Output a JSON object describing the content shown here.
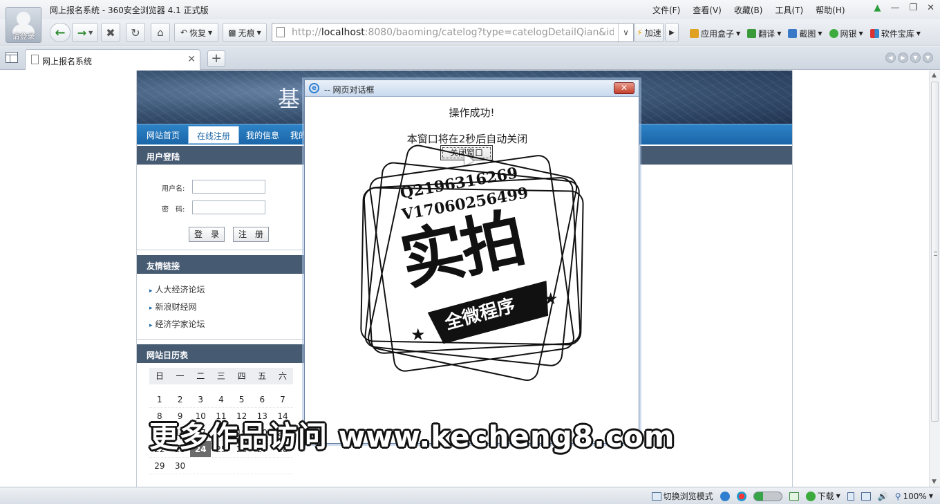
{
  "window": {
    "title": "网上报名系统 - 360安全浏览器 4.1 正式版",
    "login_label": "请登录",
    "menu": [
      "文件(F)",
      "查看(V)",
      "收藏(B)",
      "工具(T)",
      "帮助(H)"
    ]
  },
  "toolbar": {
    "restore_label": "恢复",
    "incognito_label": "无痕",
    "address_prefix": "http://",
    "address_host": "localhost",
    "address_rest": ":8080/baoming/catelog?type=catelogDetailQian&id=",
    "speed_label": "加速",
    "extensions": [
      "应用盒子",
      "翻译",
      "截图",
      "网银",
      "软件宝库"
    ]
  },
  "tabs": [
    {
      "label": "网上报名系统"
    }
  ],
  "site": {
    "banner_title": "基",
    "nav": [
      "网站首页",
      "在线注册",
      "我的信息",
      "我的"
    ],
    "login_panel": {
      "title": "用户登陆",
      "username_label": "用户名:",
      "password_label": "密　码:",
      "login_button": "登　录",
      "register_button": "注　册"
    },
    "links_panel": {
      "title": "友情链接",
      "links": [
        "人大经济论坛",
        "新浪财经网",
        "经济学家论坛"
      ]
    },
    "calendar_panel": {
      "title": "网站日历表",
      "weekdays": [
        "日",
        "一",
        "二",
        "三",
        "四",
        "五",
        "六"
      ],
      "rows": [
        [
          "1",
          "2",
          "3",
          "4",
          "5",
          "6",
          "7"
        ],
        [
          "8",
          "9",
          "10",
          "11",
          "12",
          "13",
          "14"
        ],
        [
          "15",
          "16",
          "17",
          "18",
          "19",
          "20",
          "21"
        ],
        [
          "22",
          "23",
          "24",
          "25",
          "26",
          "27",
          "28"
        ],
        [
          "29",
          "30",
          "",
          "",
          "",
          "",
          ""
        ]
      ],
      "today": "24"
    }
  },
  "dialog": {
    "title": "-- 网页对话框",
    "message": "操作成功!",
    "auto_close_text": "本窗口将在2秒后自动关闭",
    "close_button": "关闭窗口"
  },
  "watermark": {
    "line_q": "Q2196316269",
    "line_v": "V17060256499",
    "big_text": "实拍",
    "banner_text": "全微程序"
  },
  "promo_text": "更多作品访问 www.kecheng8.com",
  "statusbar": {
    "mode_label": "切换浏览模式",
    "download_label": "下载",
    "zoom": "100%"
  },
  "colors": {
    "nav_blue": "#1a66a8",
    "panel_header": "#465a72",
    "calendar_today": "#6b6b6b"
  }
}
